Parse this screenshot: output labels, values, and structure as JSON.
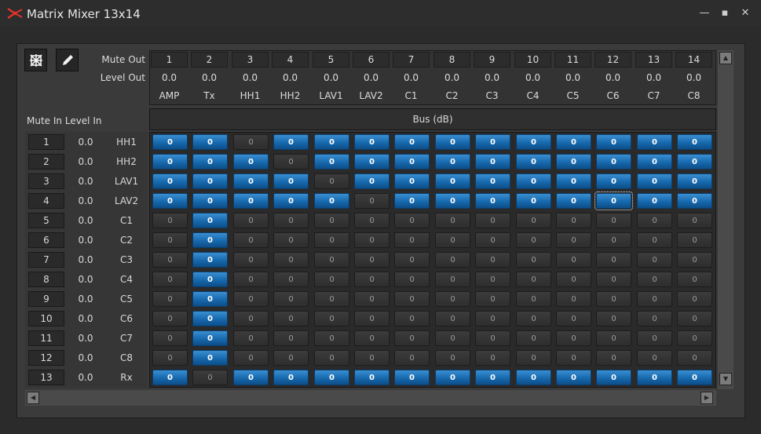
{
  "window": {
    "title": "Matrix Mixer 13x14",
    "minimize": "—",
    "maximize": "▪",
    "close": "✕"
  },
  "colors": {
    "accent_on": "#1a6eb5",
    "background": "#2b2b2b"
  },
  "toolbar": {
    "icons": [
      "matrix-icon",
      "pencil-icon"
    ]
  },
  "labels": {
    "mute_out": "Mute Out",
    "level_out": "Level Out",
    "mute_in": "Mute In",
    "level_in": "Level In",
    "bus": "Bus (dB)"
  },
  "outputs": [
    {
      "num": "1",
      "level": "0.0",
      "name": "AMP"
    },
    {
      "num": "2",
      "level": "0.0",
      "name": "Tx"
    },
    {
      "num": "3",
      "level": "0.0",
      "name": "HH1"
    },
    {
      "num": "4",
      "level": "0.0",
      "name": "HH2"
    },
    {
      "num": "5",
      "level": "0.0",
      "name": "LAV1"
    },
    {
      "num": "6",
      "level": "0.0",
      "name": "LAV2"
    },
    {
      "num": "7",
      "level": "0.0",
      "name": "C1"
    },
    {
      "num": "8",
      "level": "0.0",
      "name": "C2"
    },
    {
      "num": "9",
      "level": "0.0",
      "name": "C3"
    },
    {
      "num": "10",
      "level": "0.0",
      "name": "C4"
    },
    {
      "num": "11",
      "level": "0.0",
      "name": "C5"
    },
    {
      "num": "12",
      "level": "0.0",
      "name": "C6"
    },
    {
      "num": "13",
      "level": "0.0",
      "name": "C7"
    },
    {
      "num": "14",
      "level": "0.0",
      "name": "C8"
    }
  ],
  "inputs": [
    {
      "num": "1",
      "level": "0.0",
      "name": "HH1"
    },
    {
      "num": "2",
      "level": "0.0",
      "name": "HH2"
    },
    {
      "num": "3",
      "level": "0.0",
      "name": "LAV1"
    },
    {
      "num": "4",
      "level": "0.0",
      "name": "LAV2"
    },
    {
      "num": "5",
      "level": "0.0",
      "name": "C1"
    },
    {
      "num": "6",
      "level": "0.0",
      "name": "C2"
    },
    {
      "num": "7",
      "level": "0.0",
      "name": "C3"
    },
    {
      "num": "8",
      "level": "0.0",
      "name": "C4"
    },
    {
      "num": "9",
      "level": "0.0",
      "name": "C5"
    },
    {
      "num": "10",
      "level": "0.0",
      "name": "C6"
    },
    {
      "num": "11",
      "level": "0.0",
      "name": "C7"
    },
    {
      "num": "12",
      "level": "0.0",
      "name": "C8"
    },
    {
      "num": "13",
      "level": "0.0",
      "name": "Rx"
    }
  ],
  "matrix": {
    "cell_value": "0",
    "active": [
      [
        1,
        1,
        0,
        1,
        1,
        1,
        1,
        1,
        1,
        1,
        1,
        1,
        1,
        1
      ],
      [
        1,
        1,
        1,
        0,
        1,
        1,
        1,
        1,
        1,
        1,
        1,
        1,
        1,
        1
      ],
      [
        1,
        1,
        1,
        1,
        0,
        1,
        1,
        1,
        1,
        1,
        1,
        1,
        1,
        1
      ],
      [
        1,
        1,
        1,
        1,
        1,
        0,
        1,
        1,
        1,
        1,
        1,
        1,
        1,
        1
      ],
      [
        0,
        1,
        0,
        0,
        0,
        0,
        0,
        0,
        0,
        0,
        0,
        0,
        0,
        0
      ],
      [
        0,
        1,
        0,
        0,
        0,
        0,
        0,
        0,
        0,
        0,
        0,
        0,
        0,
        0
      ],
      [
        0,
        1,
        0,
        0,
        0,
        0,
        0,
        0,
        0,
        0,
        0,
        0,
        0,
        0
      ],
      [
        0,
        1,
        0,
        0,
        0,
        0,
        0,
        0,
        0,
        0,
        0,
        0,
        0,
        0
      ],
      [
        0,
        1,
        0,
        0,
        0,
        0,
        0,
        0,
        0,
        0,
        0,
        0,
        0,
        0
      ],
      [
        0,
        1,
        0,
        0,
        0,
        0,
        0,
        0,
        0,
        0,
        0,
        0,
        0,
        0
      ],
      [
        0,
        1,
        0,
        0,
        0,
        0,
        0,
        0,
        0,
        0,
        0,
        0,
        0,
        0
      ],
      [
        0,
        1,
        0,
        0,
        0,
        0,
        0,
        0,
        0,
        0,
        0,
        0,
        0,
        0
      ],
      [
        1,
        0,
        1,
        1,
        1,
        1,
        1,
        1,
        1,
        1,
        1,
        1,
        1,
        1
      ]
    ],
    "focused": {
      "row": 3,
      "col": 11
    }
  }
}
